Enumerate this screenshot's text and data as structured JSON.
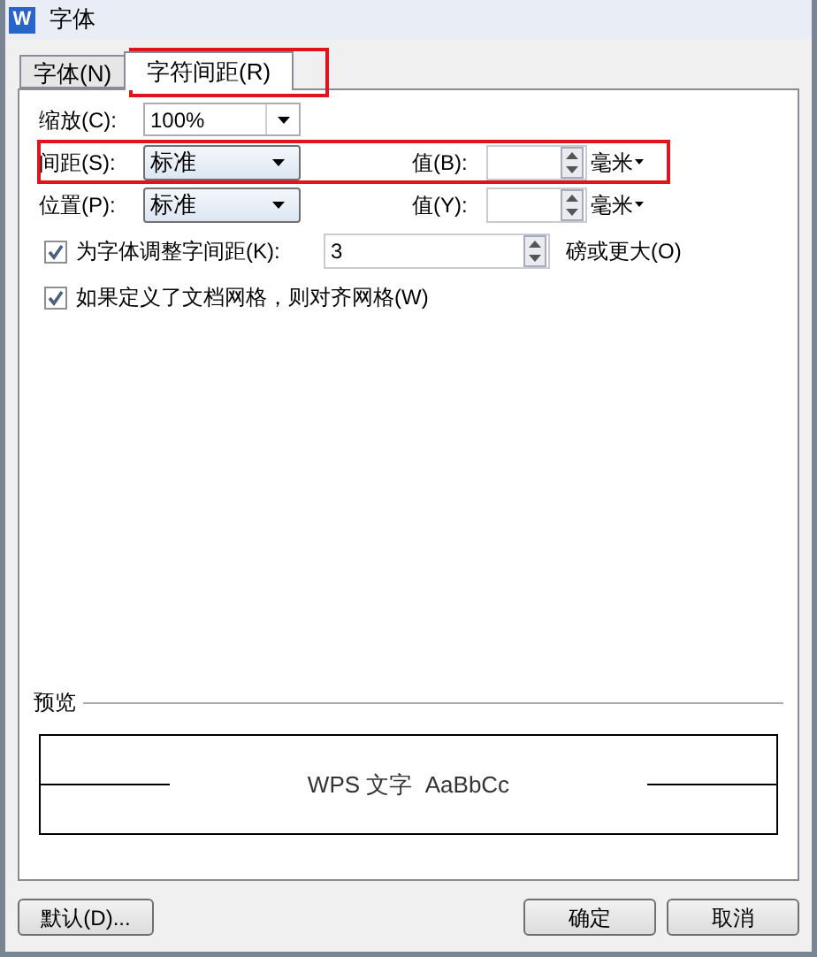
{
  "window": {
    "title": "字体",
    "icon_text": "W"
  },
  "tabs": [
    {
      "label": "字体(N)",
      "selected": false
    },
    {
      "label": "字符间距(R)",
      "selected": true
    }
  ],
  "rows": [
    {
      "kind": "editable",
      "label": "缩放(C):",
      "value": "100%"
    },
    {
      "kind": "dropdown",
      "label": "间距(S):",
      "value": "标准",
      "value_label": "值(B):",
      "unit": "毫米"
    },
    {
      "kind": "dropdown",
      "label": "位置(P):",
      "value": "标准",
      "value_label": "值(Y):",
      "unit": "毫米"
    }
  ],
  "checkboxes": [
    {
      "label": "为字体调整字间距(K):",
      "checked": true,
      "value": "3",
      "suffix": "磅或更大(O)"
    },
    {
      "label": "如果定义了文档网格，则对齐网格(W)",
      "checked": true
    }
  ],
  "preview": {
    "label": "预览",
    "sample": "WPS 文字  AaBbCc"
  },
  "buttons": [
    {
      "kind": "left",
      "label": "默认(D)..."
    },
    {
      "kind": "right",
      "label": "确定"
    },
    {
      "kind": "right",
      "label": "取消"
    }
  ]
}
